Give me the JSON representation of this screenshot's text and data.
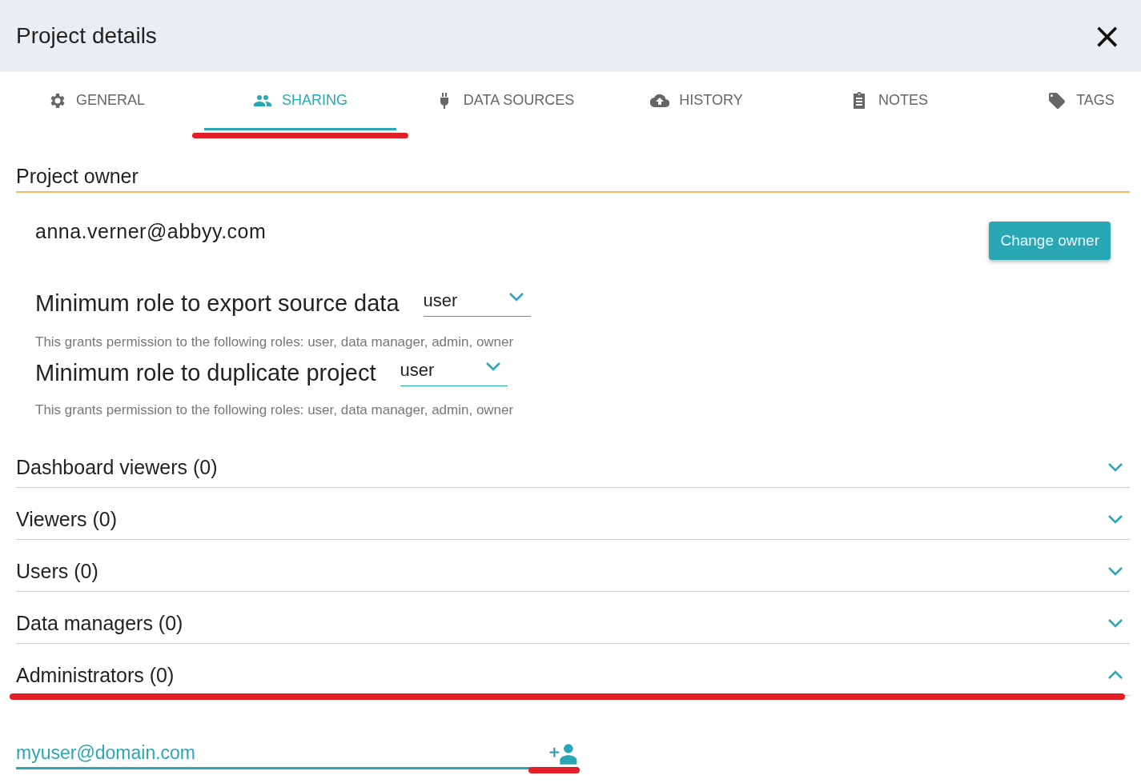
{
  "window": {
    "title": "Project details",
    "close": "×"
  },
  "tabs": [
    {
      "label": "GENERAL",
      "kind": "gear",
      "selected": false,
      "highlighted": false
    },
    {
      "label": "SHARING",
      "kind": "people",
      "selected": true,
      "highlighted": true
    },
    {
      "label": "DATA SOURCES",
      "kind": "plug",
      "selected": false,
      "highlighted": false
    },
    {
      "label": "HISTORY",
      "kind": "cloud",
      "selected": false,
      "highlighted": false
    },
    {
      "label": "NOTES",
      "kind": "clipboard",
      "selected": false,
      "highlighted": false
    },
    {
      "label": "TAGS",
      "kind": "tag",
      "selected": false,
      "highlighted": false
    }
  ],
  "owner": {
    "heading": "Project owner",
    "email": "anna.verner@abbyy.com",
    "button": "Change owner"
  },
  "roles": [
    {
      "label": "Minimum role to export source data",
      "value": "user",
      "hint": "This grants permission to the following roles: user, data manager, admin, owner"
    },
    {
      "label": "Minimum role to duplicate project",
      "value": "user",
      "hint": "This grants permission to the following roles: user, data manager, admin, owner"
    }
  ],
  "sections": [
    {
      "title": "Dashboard viewers (0)",
      "expanded": false,
      "highlighted": false
    },
    {
      "title": "Viewers (0)",
      "expanded": false,
      "highlighted": false
    },
    {
      "title": "Users (0)",
      "expanded": false,
      "highlighted": false
    },
    {
      "title": "Data managers (0)",
      "expanded": false,
      "highlighted": false
    },
    {
      "title": "Administrators (0)",
      "expanded": true,
      "highlighted": true
    }
  ],
  "add_user": {
    "value": "myuser@domain.com",
    "highlighted": true
  }
}
